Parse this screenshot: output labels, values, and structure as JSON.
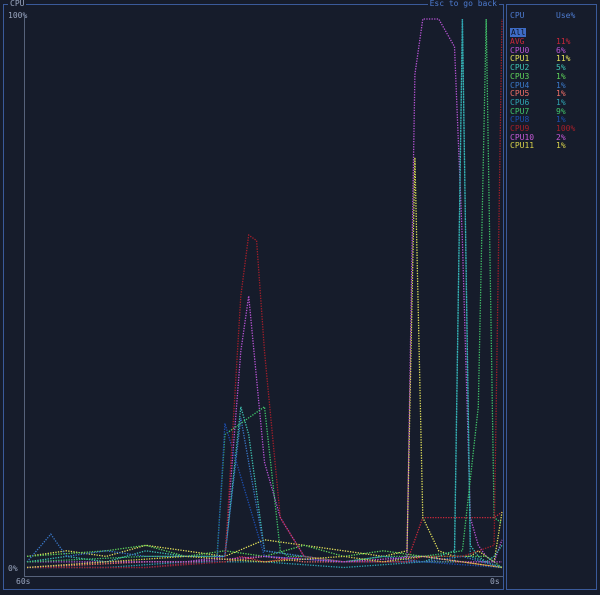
{
  "graph": {
    "title": "CPU",
    "back_hint": "Esc to go back",
    "y_max_label": "100%",
    "y_min_label": "0%",
    "x_start_label": "60s",
    "x_end_label": "0s"
  },
  "legend": {
    "header_name": "CPU",
    "header_use": "Use%",
    "all_label": "All",
    "rows": [
      {
        "name": "AVG",
        "use": "11%",
        "color": "#c8283a"
      },
      {
        "name": "CPU0",
        "use": "6%",
        "color": "#b954d6"
      },
      {
        "name": "CPU1",
        "use": "11%",
        "color": "#e3e15a"
      },
      {
        "name": "CPU2",
        "use": "5%",
        "color": "#3ec3b4"
      },
      {
        "name": "CPU3",
        "use": "1%",
        "color": "#5fd35a"
      },
      {
        "name": "CPU4",
        "use": "1%",
        "color": "#3a78c8"
      },
      {
        "name": "CPU5",
        "use": "1%",
        "color": "#ef6f67"
      },
      {
        "name": "CPU6",
        "use": "1%",
        "color": "#2fa5b3"
      },
      {
        "name": "CPU7",
        "use": "9%",
        "color": "#41c46a"
      },
      {
        "name": "CPU8",
        "use": "1%",
        "color": "#1d4fb0"
      },
      {
        "name": "CPU9",
        "use": "100%",
        "color": "#a51f2a"
      },
      {
        "name": "CPU10",
        "use": "2%",
        "color": "#c55ad7"
      },
      {
        "name": "CPU11",
        "use": "1%",
        "color": "#d9d24a"
      }
    ]
  },
  "chart_data": {
    "type": "line",
    "xlabel": "",
    "ylabel": "",
    "xlim": [
      60,
      0
    ],
    "ylim": [
      0,
      100
    ],
    "grid": false,
    "legend": "right",
    "series": [
      {
        "name": "AVG",
        "x": [
          60,
          45,
          38,
          35,
          33,
          30,
          25,
          20,
          15,
          12,
          10,
          8,
          6,
          4,
          2,
          1,
          0
        ],
        "y": [
          1,
          1,
          2,
          2,
          3,
          2,
          3,
          2,
          2,
          2,
          10,
          10,
          10,
          10,
          10,
          10,
          11
        ]
      },
      {
        "name": "CPU0",
        "x": [
          60,
          50,
          40,
          35,
          33,
          32,
          30,
          28,
          25,
          20,
          15,
          12,
          11,
          10,
          8,
          6,
          5,
          4,
          3,
          2,
          1,
          0
        ],
        "y": [
          2,
          2,
          2,
          3,
          40,
          50,
          20,
          10,
          3,
          2,
          2,
          3,
          90,
          100,
          100,
          95,
          60,
          10,
          5,
          3,
          2,
          6
        ]
      },
      {
        "name": "CPU1",
        "x": [
          60,
          55,
          50,
          45,
          40,
          35,
          30,
          25,
          20,
          15,
          12,
          11,
          10,
          8,
          6,
          4,
          3,
          2,
          1,
          0
        ],
        "y": [
          3,
          4,
          3,
          5,
          4,
          3,
          6,
          5,
          4,
          3,
          4,
          75,
          10,
          4,
          3,
          3,
          4,
          3,
          2,
          11
        ]
      },
      {
        "name": "CPU2",
        "x": [
          60,
          55,
          50,
          45,
          40,
          35,
          33,
          32,
          30,
          25,
          20,
          15,
          10,
          8,
          6,
          5,
          4,
          3,
          2,
          1,
          0
        ],
        "y": [
          2,
          3,
          2,
          4,
          3,
          3,
          30,
          25,
          4,
          3,
          2,
          3,
          2,
          3,
          4,
          100,
          5,
          3,
          2,
          3,
          5
        ]
      },
      {
        "name": "CPU3",
        "x": [
          60,
          50,
          45,
          40,
          35,
          30,
          25,
          20,
          15,
          10,
          5,
          2,
          1,
          0
        ],
        "y": [
          3,
          4,
          5,
          3,
          4,
          3,
          5,
          3,
          4,
          3,
          3,
          3,
          2,
          1
        ]
      },
      {
        "name": "CPU4",
        "x": [
          60,
          57,
          55,
          50,
          45,
          35,
          33,
          30,
          25,
          20,
          15,
          10,
          5,
          0
        ],
        "y": [
          2,
          7,
          3,
          4,
          3,
          3,
          28,
          4,
          3,
          2,
          3,
          2,
          3,
          1
        ]
      },
      {
        "name": "CPU5",
        "x": [
          60,
          45,
          35,
          30,
          25,
          20,
          15,
          10,
          5,
          0
        ],
        "y": [
          1,
          2,
          2,
          3,
          2,
          2,
          2,
          2,
          2,
          1
        ]
      },
      {
        "name": "CPU6",
        "x": [
          60,
          50,
          40,
          30,
          20,
          10,
          6,
          5,
          4,
          2,
          0
        ],
        "y": [
          1,
          1,
          2,
          2,
          1,
          2,
          2,
          100,
          3,
          2,
          1
        ]
      },
      {
        "name": "CPU7",
        "x": [
          60,
          45,
          36,
          35,
          30,
          28,
          27,
          25,
          20,
          15,
          10,
          5,
          3,
          2,
          1,
          0
        ],
        "y": [
          2,
          3,
          3,
          25,
          30,
          4,
          3,
          3,
          2,
          3,
          3,
          4,
          30,
          100,
          10,
          9
        ]
      },
      {
        "name": "CPU8",
        "x": [
          60,
          45,
          36,
          35,
          30,
          20,
          10,
          0
        ],
        "y": [
          1,
          1,
          2,
          27,
          3,
          2,
          2,
          1
        ]
      },
      {
        "name": "CPU9",
        "x": [
          60,
          45,
          35,
          33,
          32,
          31,
          30,
          28,
          25,
          20,
          12,
          10,
          5,
          1,
          0
        ],
        "y": [
          1,
          1,
          2,
          50,
          61,
          60,
          40,
          10,
          3,
          2,
          2,
          3,
          3,
          5,
          100
        ]
      },
      {
        "name": "CPU10",
        "x": [
          60,
          50,
          40,
          30,
          20,
          10,
          5,
          0
        ],
        "y": [
          1,
          2,
          2,
          3,
          2,
          3,
          2,
          2
        ]
      },
      {
        "name": "CPU11",
        "x": [
          60,
          50,
          40,
          30,
          20,
          15,
          10,
          5,
          0
        ],
        "y": [
          1,
          2,
          3,
          2,
          3,
          2,
          3,
          2,
          1
        ]
      }
    ]
  }
}
